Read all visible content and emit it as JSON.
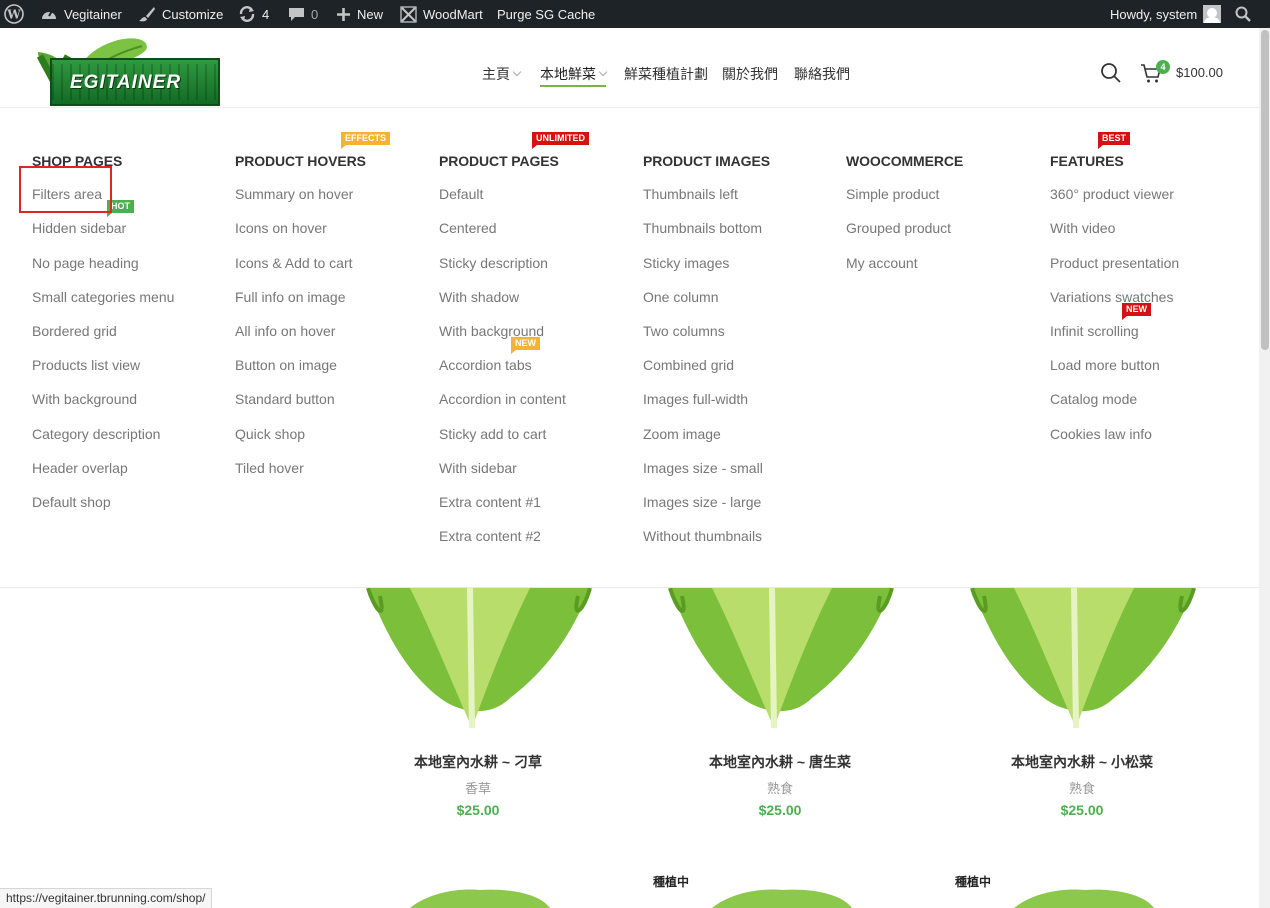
{
  "adminbar": {
    "site_name": "Vegitainer",
    "customize": "Customize",
    "updates_count": "4",
    "comments_count": "0",
    "new_label": "New",
    "woodmart": "WoodMart",
    "purge": "Purge SG Cache",
    "howdy": "Howdy, system"
  },
  "logo": {
    "text": "EGITAINER"
  },
  "nav": {
    "items": [
      {
        "label": "主頁"
      },
      {
        "label": "本地鮮菜"
      },
      {
        "label": "鮮菜種植計劃"
      },
      {
        "label": "關於我們"
      },
      {
        "label": "聯絡我們"
      }
    ]
  },
  "cart": {
    "count": "4",
    "total": "$100.00"
  },
  "mega": {
    "columns": [
      {
        "title": "SHOP PAGES",
        "items": [
          "Filters area",
          "Hidden sidebar",
          "No page heading",
          "Small categories menu",
          "Bordered grid",
          "Products list view",
          "With background",
          "Category description",
          "Header overlap",
          "Default shop"
        ]
      },
      {
        "title": "PRODUCT HOVERS",
        "items": [
          "Summary on hover",
          "Icons on hover",
          "Icons & Add to cart",
          "Full info on image",
          "All info on hover",
          "Button on image",
          "Standard button",
          "Quick shop",
          "Tiled hover"
        ]
      },
      {
        "title": "PRODUCT PAGES",
        "items": [
          "Default",
          "Centered",
          "Sticky description",
          "With shadow",
          "With background",
          "Accordion tabs",
          "Accordion in content",
          "Sticky add to cart",
          "With sidebar",
          "Extra content #1",
          "Extra content #2"
        ]
      },
      {
        "title": "PRODUCT IMAGES",
        "items": [
          "Thumbnails left",
          "Thumbnails bottom",
          "Sticky images",
          "One column",
          "Two columns",
          "Combined grid",
          "Images full-width",
          "Zoom image",
          "Images size - small",
          "Images size - large",
          "Without thumbnails"
        ]
      },
      {
        "title": "WOOCOMMERCE",
        "items": [
          "Simple product",
          "Grouped product",
          "My account"
        ]
      },
      {
        "title": "FEATURES",
        "items": [
          "360° product viewer",
          "With video",
          "Product presentation",
          "Variations swatches",
          "Infinit scrolling",
          "Load more button",
          "Catalog mode",
          "Cookies law info"
        ]
      }
    ],
    "tags": {
      "effects": "EFFECTS",
      "unlimited": "UNLIMITED",
      "best": "BEST",
      "hot": "HOT",
      "new_a": "NEW",
      "new_b": "NEW"
    }
  },
  "products": [
    {
      "name": "本地室內水耕 ~ 刁草",
      "category": "香草",
      "price": "$25.00"
    },
    {
      "name": "本地室內水耕 ~ 唐生菜",
      "category": "熟食",
      "price": "$25.00"
    },
    {
      "name": "本地室內水耕 ~ 小松菜",
      "category": "熟食",
      "price": "$25.00"
    }
  ],
  "badges": {
    "growing_1": "種植中",
    "growing_2": "種植中"
  },
  "status_url": "https://vegitainer.tbrunning.com/shop/",
  "colors": {
    "accent_green": "#4caf50",
    "adminbar": "#1d2327",
    "tag_orange": "#f5b335",
    "tag_red": "#d41212"
  }
}
